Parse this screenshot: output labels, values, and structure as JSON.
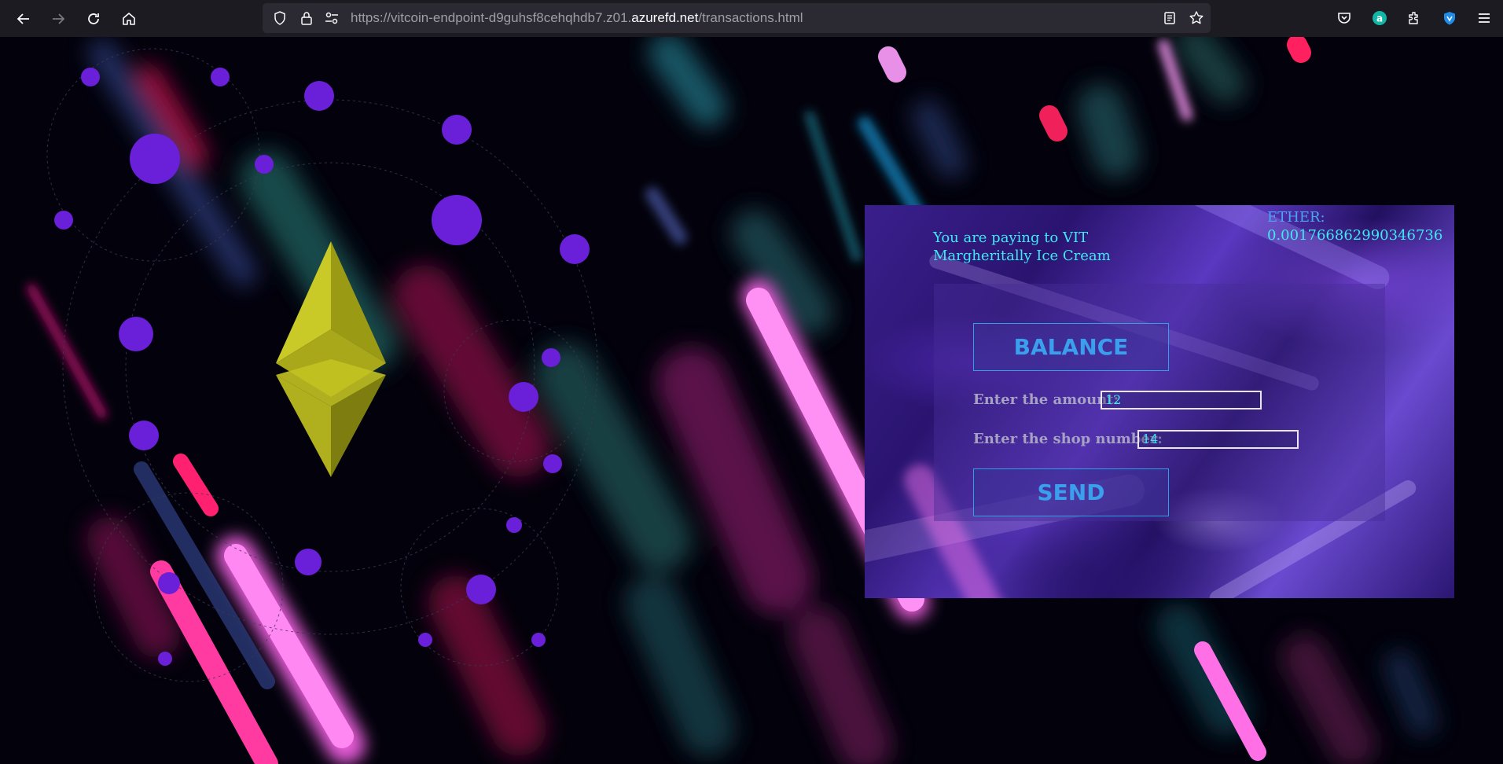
{
  "browser": {
    "url_prefix": "https://vitcoin-endpoint-d9guhsf8cehqhdb7.z01.",
    "url_domain": "azurefd.net",
    "url_suffix": "/transactions.html"
  },
  "payment": {
    "paying_to_line1": "You are paying to VIT",
    "paying_to_line2": "Margheritally Ice Cream",
    "ether_label": "ETHER:",
    "ether_value": "0.001766862990346736",
    "balance_button": "BALANCE",
    "amount_label": "Enter the amount:",
    "amount_value": "12",
    "shop_label": "Enter the shop number:",
    "shop_value": "14",
    "send_button": "SEND"
  },
  "colors": {
    "accent_cyan": "#3fe8f2",
    "button_text": "#3aa0ee",
    "panel_purple": "#3a1f8c",
    "ether_logo": "#b8b81c",
    "orbit_dots": "#6a1fd8"
  },
  "icons": [
    "back-icon",
    "forward-icon",
    "reload-icon",
    "home-icon",
    "shield-icon",
    "lock-icon",
    "permissions-icon",
    "reader-icon",
    "bookmark-star-icon",
    "pocket-icon",
    "account-icon",
    "extensions-icon",
    "vpn-icon",
    "menu-icon",
    "ethereum-logo-icon"
  ]
}
